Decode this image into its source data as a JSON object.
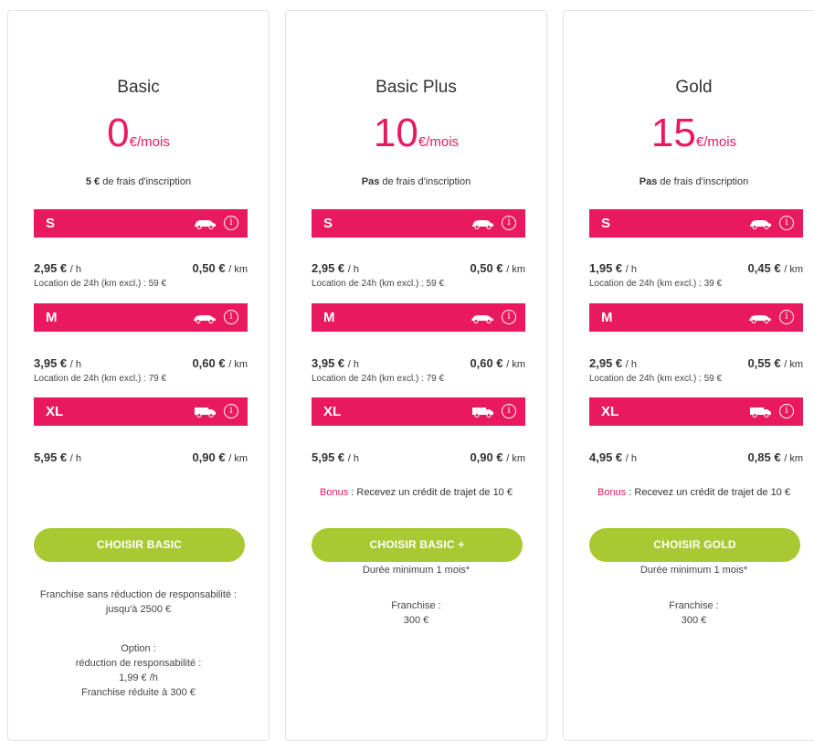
{
  "colors": {
    "accent": "#e8195f",
    "button": "#a8c932",
    "border": "#e2e2e2"
  },
  "plans": [
    {
      "name": "Basic",
      "price": "0",
      "unit": "€/mois",
      "fee_bold": "5 €",
      "fee_rest": " de frais d'inscription",
      "tiers": [
        {
          "size": "S",
          "icon": "car-icon",
          "per_h": "2,95 €",
          "per_km": "0,50 €",
          "location": "Location de 24h (km excl.) : 59 €"
        },
        {
          "size": "M",
          "icon": "car-icon",
          "per_h": "3,95 €",
          "per_km": "0,60 €",
          "location": "Location de 24h (km excl.) : 79 €"
        },
        {
          "size": "XL",
          "icon": "van-icon",
          "per_h": "5,95 €",
          "per_km": "0,90 €"
        }
      ],
      "button": "CHOISIR BASIC",
      "franchise_line1": "Franchise sans réduction de responsabilité :",
      "franchise_line2": "jusqu'à 2500 €",
      "option_line1": "Option :",
      "option_line2": "réduction de responsabilité :",
      "option_line3": "1,99 € /h",
      "option_line4": "Franchise réduite à 300 €"
    },
    {
      "name": "Basic Plus",
      "price": "10",
      "unit": "€/mois",
      "fee_bold": "Pas",
      "fee_rest": " de frais d'inscription",
      "tiers": [
        {
          "size": "S",
          "icon": "car-icon",
          "per_h": "2,95 €",
          "per_km": "0,50 €",
          "location": "Location de 24h (km excl.) : 59 €"
        },
        {
          "size": "M",
          "icon": "car-icon",
          "per_h": "3,95 €",
          "per_km": "0,60 €",
          "location": "Location de 24h (km excl.) : 79 €"
        },
        {
          "size": "XL",
          "icon": "van-icon",
          "per_h": "5,95 €",
          "per_km": "0,90 €"
        }
      ],
      "bonus_label": "Bonus",
      "bonus_text": " : Recevez un crédit de trajet de 10 €",
      "button": "CHOISIR BASIC +",
      "duration": "Durée minimum 1 mois*",
      "franchise_label": "Franchise :",
      "franchise_value": "300 €"
    },
    {
      "name": "Gold",
      "price": "15",
      "unit": "€/mois",
      "fee_bold": "Pas",
      "fee_rest": " de frais d'inscription",
      "tiers": [
        {
          "size": "S",
          "icon": "car-icon",
          "per_h": "1,95 €",
          "per_km": "0,45 €",
          "location": "Location de 24h (km excl.) : 39 €"
        },
        {
          "size": "M",
          "icon": "car-icon",
          "per_h": "2,95 €",
          "per_km": "0,55 €",
          "location": "Location de 24h (km excl.) : 59 €"
        },
        {
          "size": "XL",
          "icon": "van-icon",
          "per_h": "4,95 €",
          "per_km": "0,85 €"
        }
      ],
      "bonus_label": "Bonus",
      "bonus_text": " : Recevez un crédit de trajet de 10 €",
      "button": "CHOISIR GOLD",
      "duration": "Durée minimum 1 mois*",
      "franchise_label": "Franchise :",
      "franchise_value": "300 €"
    }
  ],
  "units": {
    "per_h": "/ h",
    "per_km": "/ km"
  },
  "info_glyph": "i"
}
